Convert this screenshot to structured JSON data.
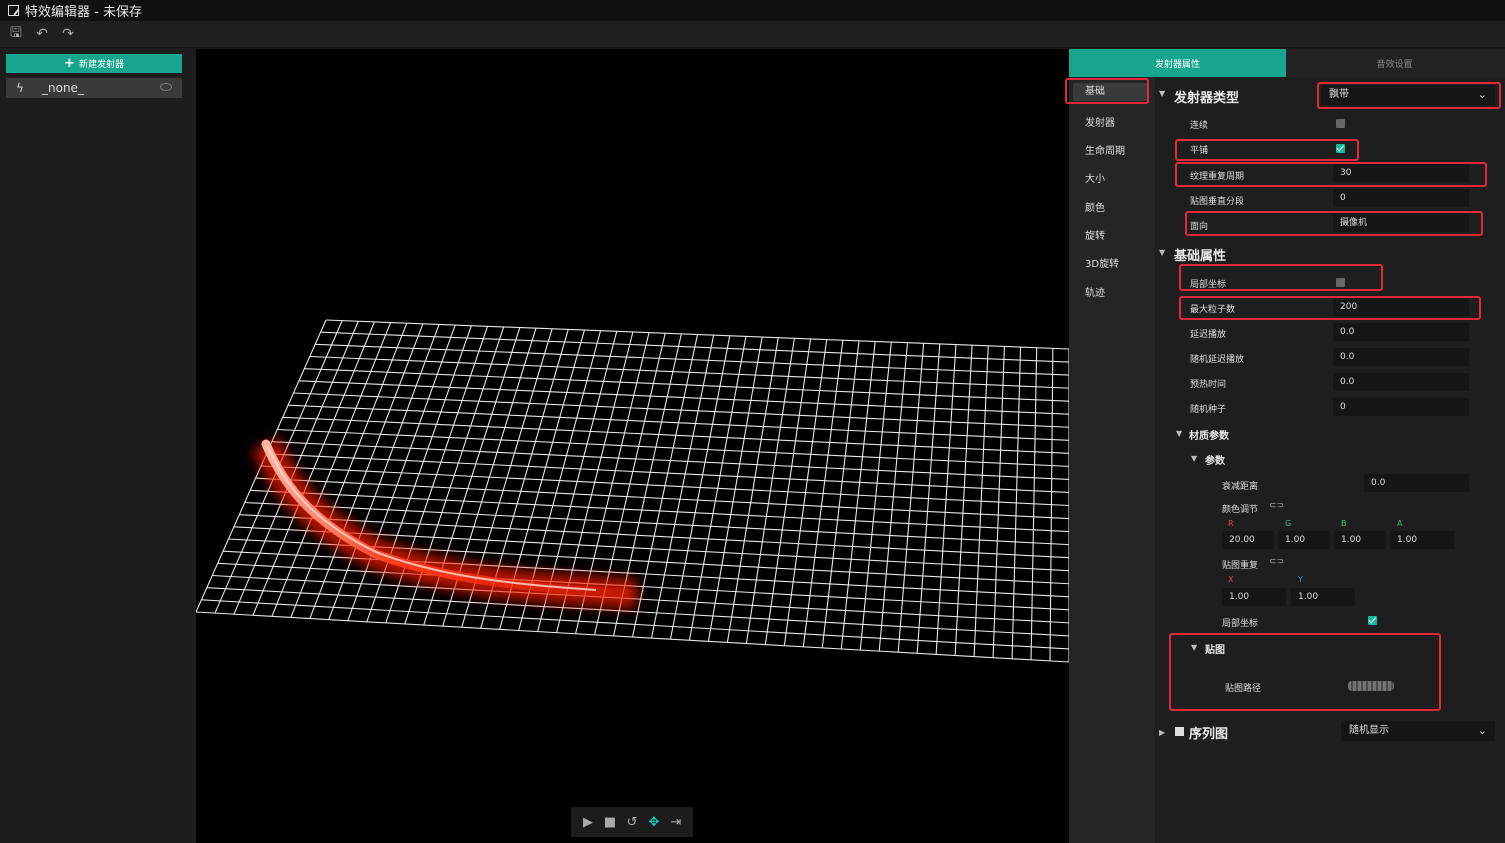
{
  "window": {
    "title": "特效编辑器 - 未保存"
  },
  "toolbar": {
    "icons": [
      "save-icon",
      "undo-icon",
      "redo-icon"
    ]
  },
  "left": {
    "new_emitter_label": "新建发射器",
    "emitter_name": "_none_"
  },
  "playback": {
    "icons": [
      "play-icon",
      "stop-icon",
      "restart-icon",
      "move-icon",
      "step-icon"
    ]
  },
  "tabs": {
    "emitter_props": "发射器属性",
    "sound_settings": "音效设置"
  },
  "categories": [
    "基础",
    "发射器",
    "生命周期",
    "大小",
    "颜色",
    "旋转",
    "3D旋转",
    "轨迹"
  ],
  "props": {
    "emitter_type_label": "发射器类型",
    "emitter_type_value": "飘带",
    "continuous_label": "连续",
    "tile_label": "平铺",
    "texture_repeat_label": "纹理重复周期",
    "texture_repeat_value": "30",
    "vertical_segments_label": "贴图垂直分段",
    "vertical_segments_value": "0",
    "facing_label": "面向",
    "facing_value": "摄像机",
    "basic_props_label": "基础属性",
    "local_coords_label": "局部坐标",
    "max_particles_label": "最大粒子数",
    "max_particles_value": "200",
    "delay_play_label": "延迟播放",
    "delay_play_value": "0.0",
    "random_delay_label": "随机延迟播放",
    "random_delay_value": "0.0",
    "prewarm_label": "预热时间",
    "prewarm_value": "0.0",
    "random_seed_label": "随机种子",
    "random_seed_value": "0",
    "material_params_label": "材质参数",
    "params_label": "参数",
    "fade_distance_label": "衰减距离",
    "fade_distance_value": "0.0",
    "color_adjust_label": "颜色调节",
    "r_label": "R",
    "g_label": "G",
    "b_label": "B",
    "a_label": "A",
    "r_value": "20.00",
    "g_value": "1.00",
    "b_value": "1.00",
    "a_value": "1.00",
    "texture_repeat2_label": "贴图重复",
    "x_label": "X",
    "y_label": "Y",
    "x_value": "1.00",
    "y_value": "1.00",
    "local_coords2_label": "局部坐标",
    "texture_label": "贴图",
    "texture_path_label": "贴图路径",
    "sequence_label": "序列图",
    "sequence_value": "随机显示"
  },
  "colors": {
    "accent": "#17a58e",
    "highlight": "#e4283c"
  }
}
